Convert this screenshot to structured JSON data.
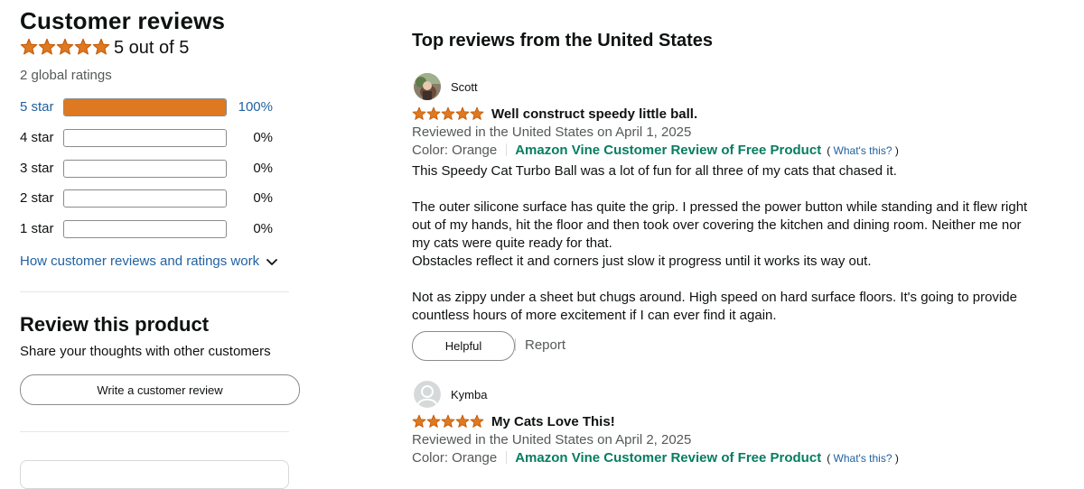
{
  "colors": {
    "star": "#de7921",
    "link": "#2162a1",
    "vine": "#067d62",
    "muted": "#565959"
  },
  "summary": {
    "title": "Customer reviews",
    "rating": 5,
    "average_text": "5 out of 5",
    "global_ratings": "2 global ratings",
    "histogram": [
      {
        "label": "5 star",
        "percent_text": "100%",
        "fill_fraction": 1.0
      },
      {
        "label": "4 star",
        "percent_text": "0%",
        "fill_fraction": 0
      },
      {
        "label": "3 star",
        "percent_text": "0%",
        "fill_fraction": 0
      },
      {
        "label": "2 star",
        "percent_text": "0%",
        "fill_fraction": 0
      },
      {
        "label": "1 star",
        "percent_text": "0%",
        "fill_fraction": 0
      }
    ],
    "how_link": "How customer reviews and ratings work",
    "how_icon": "chevron-down-icon"
  },
  "review_this": {
    "title": "Review this product",
    "subtitle": "Share your thoughts with other customers",
    "button": "Write a customer review"
  },
  "reviews_section": {
    "title": "Top reviews from the United States"
  },
  "reviews": [
    {
      "reviewer": "Scott",
      "rating": 5,
      "title": "Well construct speedy little ball.",
      "date": "Reviewed in the United States on April 1, 2025",
      "color": "Color: Orange",
      "vine": "Amazon Vine Customer Review of Free Product",
      "whats_this_open": "(",
      "whats_this": "What's this?",
      "whats_this_close": ")",
      "body_p1": "This Speedy Cat Turbo Ball was a lot of fun for all three of my cats that chased it.",
      "body_p2": "The outer silicone surface has quite the grip. I pressed the power button while standing and it flew right out of my hands, hit the floor and then took over covering the kitchen and dining room. Neither me nor my cats were quite ready for that.",
      "body_p3": "Obstacles reflect it and corners just slow it progress until it works its way out.",
      "body_p4": "Not as zippy under a sheet but chugs around. High speed on hard surface floors. It's going to provide countless hours of more excitement if I can ever find it again.",
      "helpful": "Helpful",
      "report": "Report"
    },
    {
      "reviewer": "Kymba",
      "rating": 5,
      "title": "My Cats Love This!",
      "date": "Reviewed in the United States on April 2, 2025",
      "color": "Color: Orange",
      "vine": "Amazon Vine Customer Review of Free Product",
      "whats_this_open": "(",
      "whats_this": "What's this?",
      "whats_this_close": ")"
    }
  ]
}
